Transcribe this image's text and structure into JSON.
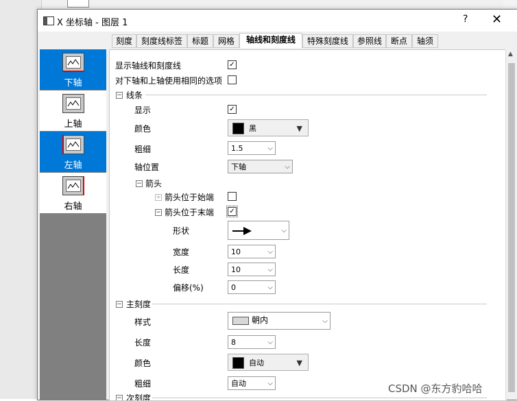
{
  "window": {
    "title": "X 坐标轴 - 图层 1",
    "help_label": "?",
    "close_label": "✕"
  },
  "tabs": [
    "刻度",
    "刻度线标签",
    "标题",
    "网格",
    "轴线和刻度线",
    "特殊刻度线",
    "参照线",
    "断点",
    "轴须"
  ],
  "active_tab": "轴线和刻度线",
  "sidebar": {
    "items": [
      {
        "label": "下轴",
        "selected": true,
        "icon": "axis-bottom-icon"
      },
      {
        "label": "上轴",
        "selected": false,
        "icon": "axis-top-icon"
      },
      {
        "label": "左轴",
        "selected": true,
        "icon": "axis-left-icon"
      },
      {
        "label": "右轴",
        "selected": false,
        "icon": "axis-right-icon"
      }
    ]
  },
  "panel": {
    "show_axis_ticks": {
      "label": "显示轴线和刻度线",
      "checked": true
    },
    "same_options": {
      "label": "对下轴和上轴使用相同的选项",
      "checked": false
    },
    "line_section": {
      "title": "线条",
      "show": {
        "label": "显示",
        "checked": true
      },
      "color": {
        "label": "颜色",
        "value": "黑",
        "swatch": "#000000"
      },
      "thickness": {
        "label": "粗细",
        "value": "1.5"
      },
      "axis_position": {
        "label": "轴位置",
        "value": "下轴"
      },
      "arrow": {
        "title": "箭头",
        "at_start": {
          "label": "箭头位于始端",
          "checked": false
        },
        "at_end": {
          "label": "箭头位于末端",
          "checked": true
        },
        "shape": {
          "label": "形状"
        },
        "width": {
          "label": "宽度",
          "value": "10"
        },
        "length": {
          "label": "长度",
          "value": "10"
        },
        "offset": {
          "label": "偏移(%)",
          "value": "0"
        }
      }
    },
    "major_ticks": {
      "title": "主刻度",
      "style": {
        "label": "样式",
        "value": "朝内"
      },
      "length": {
        "label": "长度",
        "value": "8"
      },
      "color": {
        "label": "颜色",
        "value": "自动",
        "swatch": "#000000"
      },
      "thickness": {
        "label": "粗细",
        "value": "自动"
      }
    },
    "minor_ticks": {
      "title": "次刻度"
    }
  },
  "watermark": "CSDN @东方豹哈哈",
  "colors": {
    "selection": "#0078d7",
    "axis_highlight": "#e00000"
  }
}
